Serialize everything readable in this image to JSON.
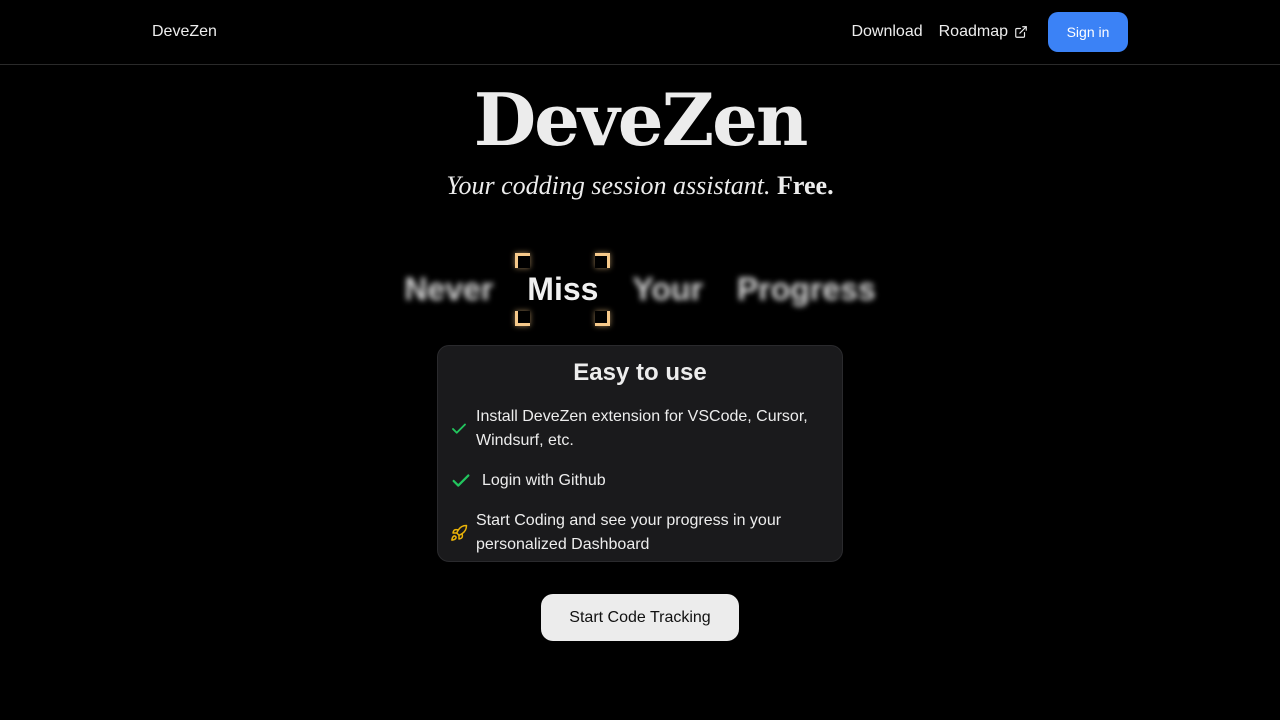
{
  "header": {
    "brand": "DeveZen",
    "nav": {
      "download": "Download",
      "roadmap": "Roadmap",
      "signin": "Sign in"
    }
  },
  "hero": {
    "title": "DeveZen",
    "tagline": "Your codding session assistant.",
    "free": "Free."
  },
  "rotator": {
    "words": [
      "Never",
      "Miss",
      "Your",
      "Progress"
    ],
    "focused_word": "Miss",
    "focus_color": "#f6c98a"
  },
  "card": {
    "title": "Easy to use",
    "steps": [
      {
        "icon": "check-icon",
        "text": "Install DeveZen extension for VSCode, Cursor, Windsurf, etc."
      },
      {
        "icon": "check-icon",
        "text": "Login with Github"
      },
      {
        "icon": "rocket-icon",
        "text": "Start Coding and see your progress in your personalized Dashboard"
      }
    ]
  },
  "cta": {
    "label": "Start Code Tracking"
  },
  "colors": {
    "background": "#000000",
    "accent_button": "#3b82f6",
    "check_green": "#22c55e",
    "rocket_yellow": "#eab308",
    "card_bg": "#1a1a1c"
  }
}
